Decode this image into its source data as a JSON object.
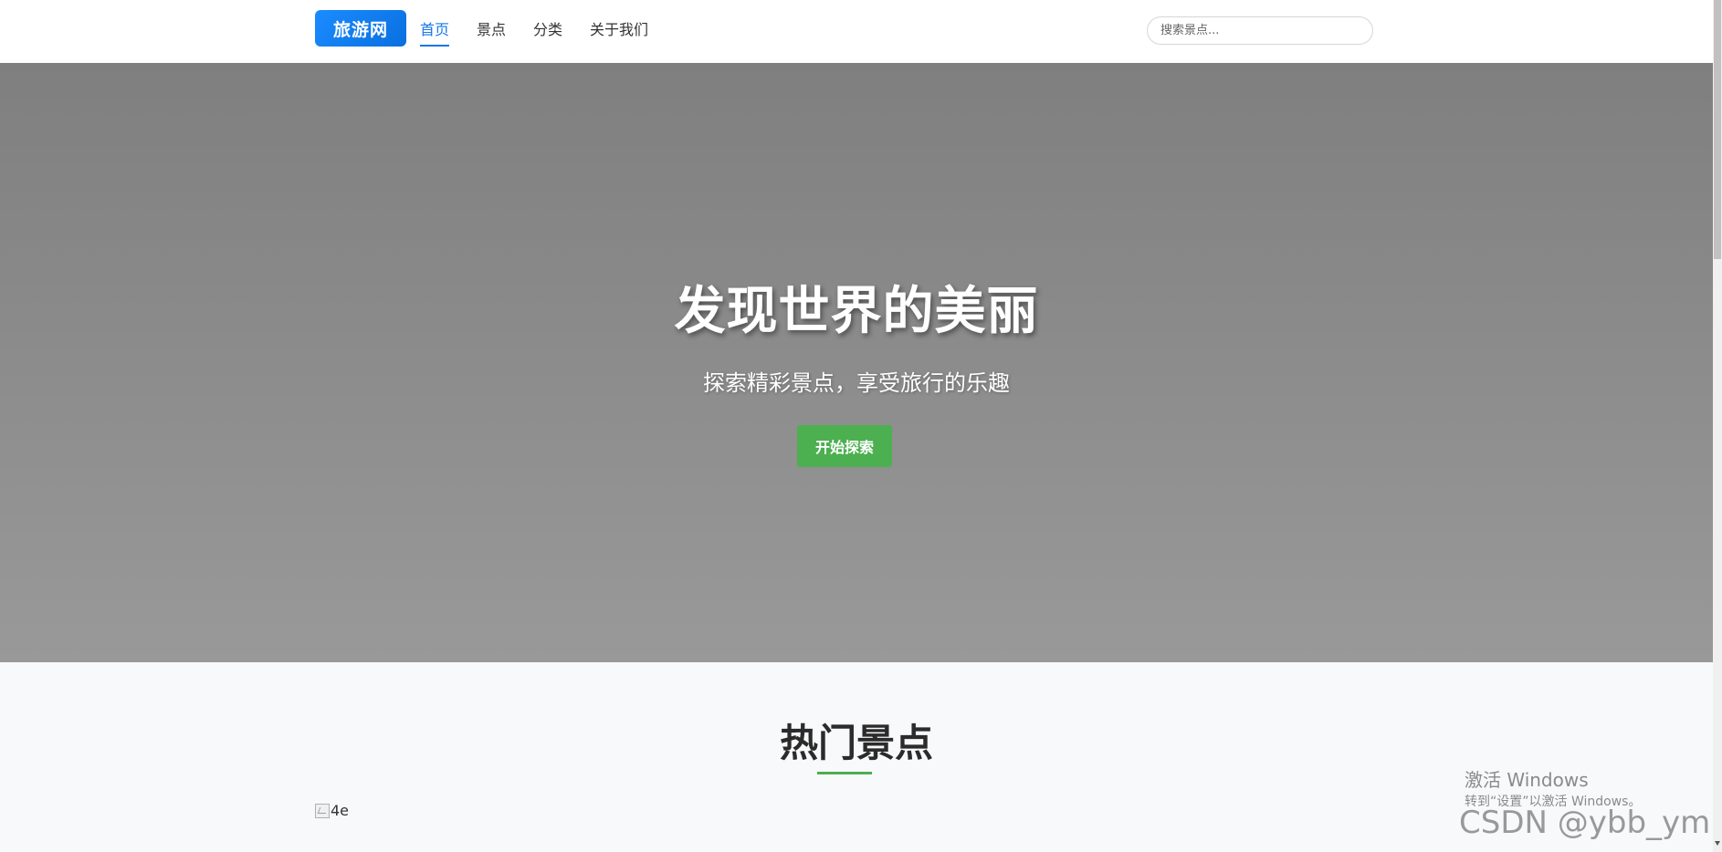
{
  "header": {
    "logo": "旅游网",
    "nav": [
      "首页",
      "景点",
      "分类",
      "关于我们"
    ],
    "active_nav": "首页",
    "search_placeholder": "搜索景点..."
  },
  "hero": {
    "title": "发现世界的美丽",
    "subtitle": "探索精彩景点，享受旅行的乐趣",
    "button": "开始探索"
  },
  "popular": {
    "title": "热门景点",
    "image_alt": "4e"
  },
  "watermark": {
    "activate_title": "激活 Windows",
    "activate_sub": "转到“设置”以激活 Windows。",
    "csdn": "CSDN @ybb_ymm"
  },
  "colors": {
    "accent_blue": "#1677e6",
    "accent_green": "#4caf50"
  }
}
